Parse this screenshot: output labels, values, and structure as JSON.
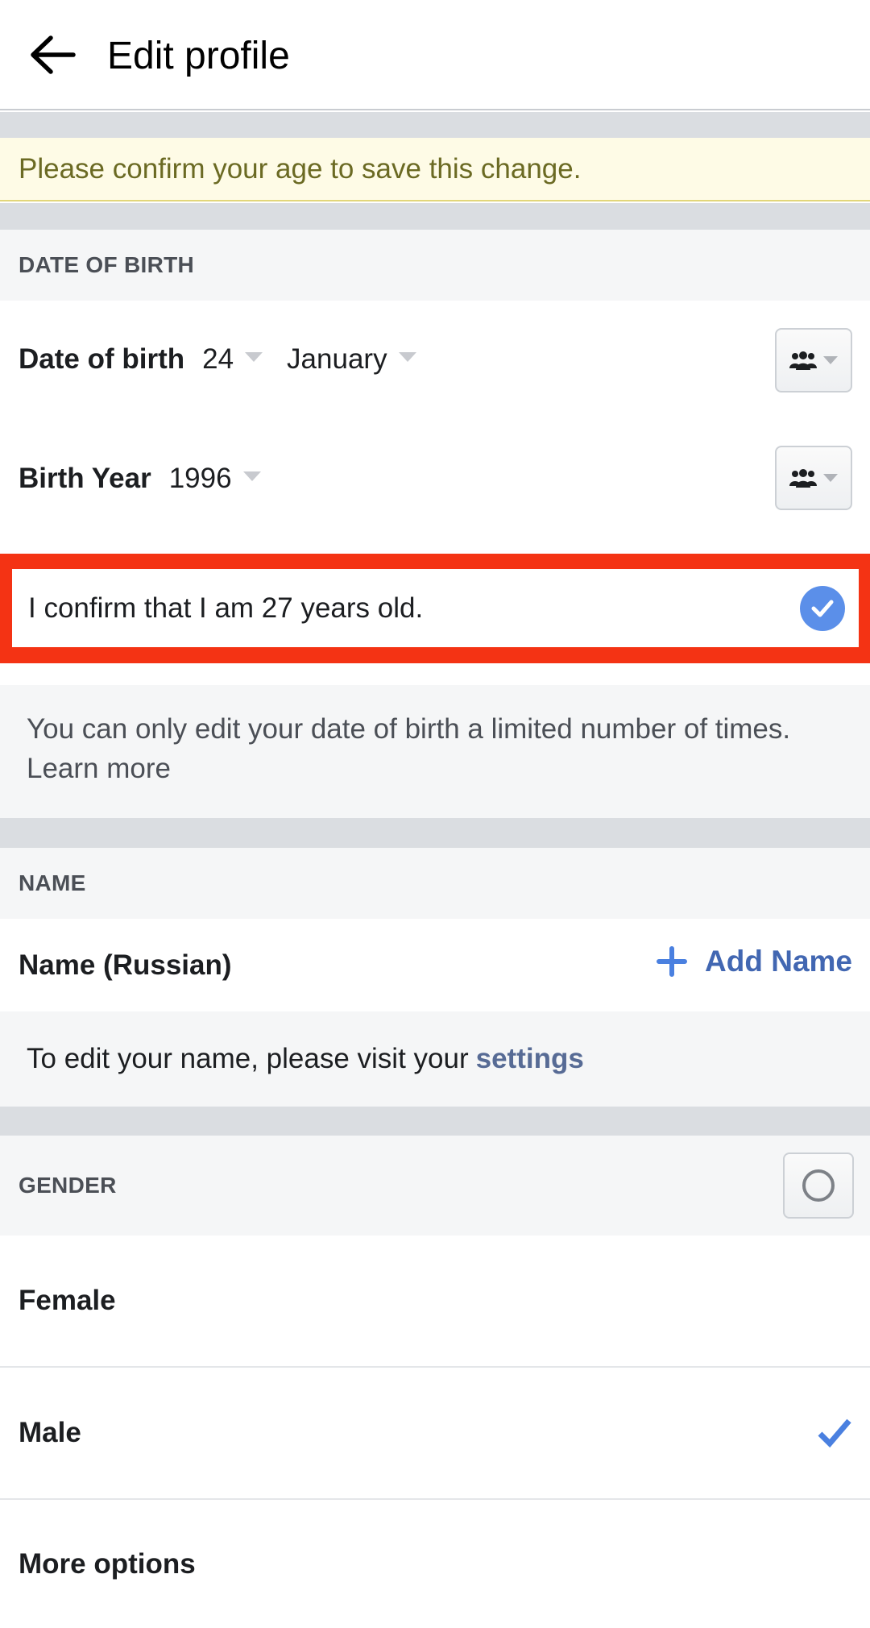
{
  "header": {
    "title": "Edit profile",
    "back_icon": "arrow-left-icon"
  },
  "banner": {
    "text": "Please confirm your age to save this change."
  },
  "date_of_birth_section": {
    "heading": "DATE OF BIRTH",
    "date_row": {
      "label": "Date of birth",
      "day": "24",
      "month": "January",
      "privacy_icon": "friends-icon"
    },
    "year_row": {
      "label": "Birth Year",
      "year": "1996",
      "privacy_icon": "friends-icon"
    },
    "confirm": {
      "text": "I confirm that I am 27 years old.",
      "checked": true,
      "highlight_color": "#f43314",
      "check_color": "#5b8fe9"
    },
    "info": {
      "text": "You can only edit your date of birth a limited number of times.",
      "link": "Learn more"
    }
  },
  "name_section": {
    "heading": "NAME",
    "row_label": "Name (Russian)",
    "add_button": "Add Name",
    "note_text": "To edit your name, please visit your",
    "note_link": "settings"
  },
  "gender_section": {
    "heading": "GENDER",
    "options": [
      {
        "label": "Female",
        "selected": false
      },
      {
        "label": "Male",
        "selected": true
      },
      {
        "label": "More options",
        "selected": false
      }
    ],
    "accent_color": "#4a80e0"
  }
}
